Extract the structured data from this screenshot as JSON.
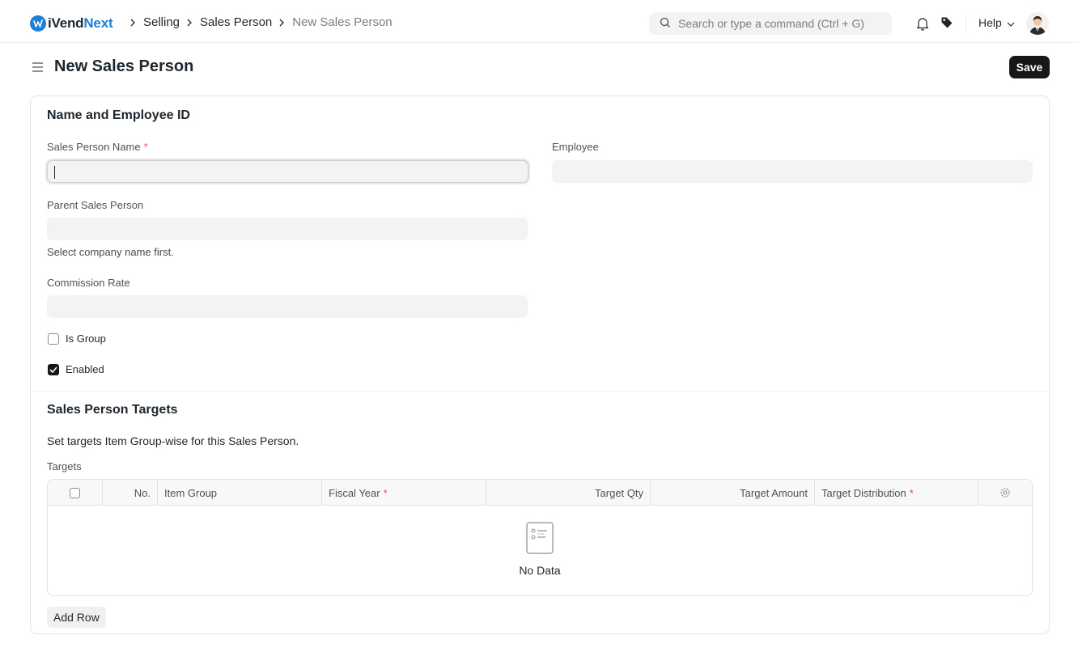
{
  "navbar": {
    "logo": {
      "part1": "iVend",
      "part2": "Next"
    },
    "breadcrumbs": [
      "Selling",
      "Sales Person",
      "New Sales Person"
    ],
    "search": {
      "placeholder": "Search or type a command (Ctrl + G)"
    },
    "help_label": "Help"
  },
  "page": {
    "title": "New Sales Person",
    "save_label": "Save"
  },
  "section1": {
    "title": "Name and Employee ID",
    "sales_person_name": {
      "label": "Sales Person Name",
      "required": "*",
      "value": ""
    },
    "employee": {
      "label": "Employee",
      "value": ""
    },
    "parent_sales_person": {
      "label": "Parent Sales Person",
      "value": "",
      "help": "Select company name first."
    },
    "commission_rate": {
      "label": "Commission Rate",
      "value": ""
    },
    "is_group": {
      "label": "Is Group",
      "checked": false
    },
    "enabled": {
      "label": "Enabled",
      "checked": true
    }
  },
  "section2": {
    "title": "Sales Person Targets",
    "description": "Set targets Item Group-wise for this Sales Person.",
    "targets_label": "Targets",
    "columns": [
      "No.",
      "Item Group",
      "Fiscal Year",
      "Target Qty",
      "Target Amount",
      "Target Distribution"
    ],
    "required_mark": "*",
    "empty_text": "No Data",
    "add_row_label": "Add Row"
  },
  "colors": {
    "brand": "#1c7ed6",
    "primary_button": "#171717",
    "required": "#e24c4c"
  }
}
